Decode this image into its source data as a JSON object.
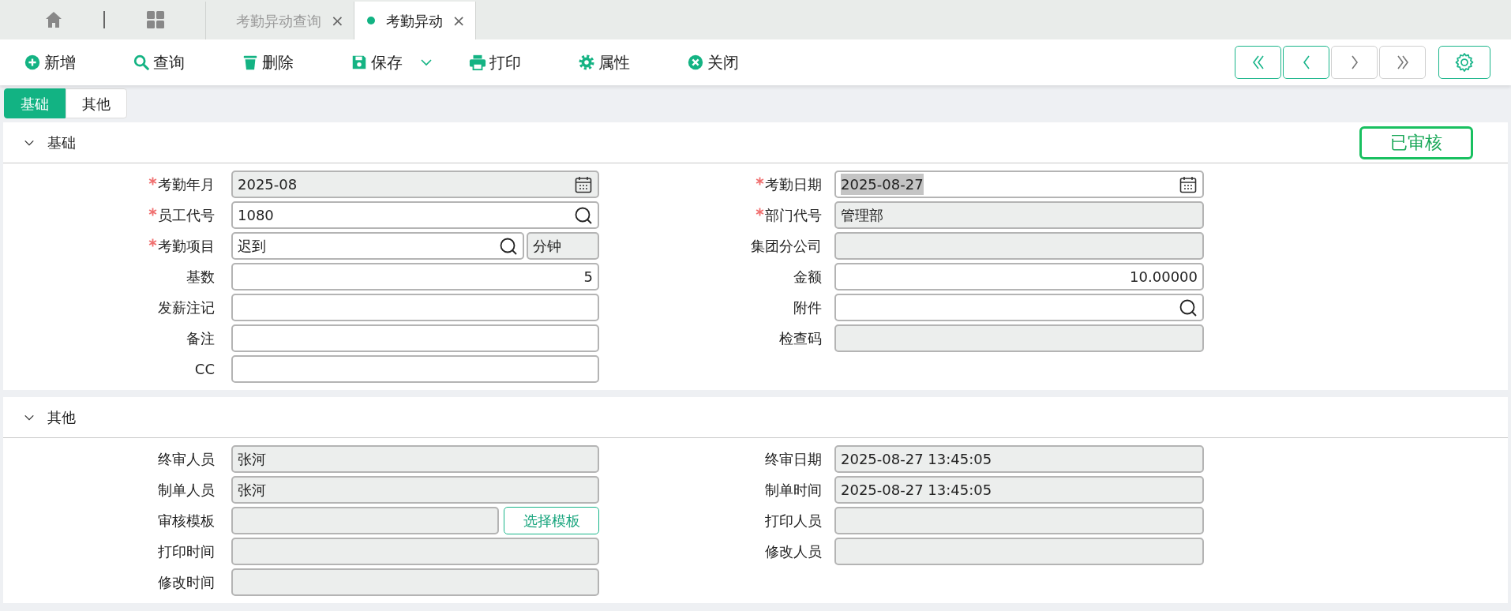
{
  "tabs": [
    {
      "label": "考勤异动查询",
      "close": "×",
      "selected": false
    },
    {
      "label": "考勤异动",
      "close": "×",
      "selected": true
    }
  ],
  "toolbar": [
    {
      "kind": "add",
      "label": "新增",
      "has_menu": false
    },
    {
      "kind": "search",
      "label": "查询",
      "has_menu": false
    },
    {
      "kind": "delete",
      "label": "删除",
      "has_menu": false
    },
    {
      "kind": "save",
      "label": "保存",
      "has_menu": true
    },
    {
      "kind": "print",
      "label": "打印",
      "has_menu": false
    },
    {
      "kind": "properties",
      "label": "属性",
      "has_menu": false
    },
    {
      "kind": "close",
      "label": "关闭",
      "has_menu": false
    }
  ],
  "pager": [
    {
      "kind": "first",
      "disabled": false
    },
    {
      "kind": "previous",
      "disabled": false
    },
    {
      "kind": "next",
      "disabled": true
    },
    {
      "kind": "last",
      "disabled": true
    }
  ],
  "subtabs": [
    {
      "label": "基础",
      "selected": true
    },
    {
      "label": "其他",
      "selected": false
    }
  ],
  "sections": [
    {
      "title": "基础",
      "expanded": true,
      "status": "已审核",
      "columns": [
        [
          {
            "label": "考勤年月",
            "required": true,
            "kind": "date",
            "value": "2025-08",
            "readonly": true
          },
          {
            "label": "员工代号",
            "required": true,
            "kind": "lookup",
            "value": "1080",
            "readonly": false
          },
          {
            "label": "考勤项目",
            "required": true,
            "kind": "lookup",
            "value": "迟到",
            "unit": "分钟",
            "readonly": false
          },
          {
            "label": "基数",
            "required": false,
            "kind": "number",
            "value": "5",
            "readonly": false
          },
          {
            "label": "发薪注记",
            "required": false,
            "kind": "text",
            "readonly": false
          },
          {
            "label": "备注",
            "required": false,
            "kind": "text",
            "readonly": false
          },
          {
            "label": "CC",
            "required": false,
            "kind": "text",
            "readonly": false
          }
        ],
        [
          {
            "label": "考勤日期",
            "required": true,
            "kind": "date",
            "value": "2025-08-27",
            "readonly": false,
            "text_selected": true
          },
          {
            "label": "部门代号",
            "required": true,
            "kind": "text",
            "value": "管理部",
            "readonly": true
          },
          {
            "label": "集团分公司",
            "required": false,
            "kind": "text",
            "readonly": true
          },
          {
            "label": "金额",
            "required": false,
            "kind": "number",
            "value": "10.00000",
            "readonly": false
          },
          {
            "label": "附件",
            "required": false,
            "kind": "lookup",
            "readonly": false
          },
          {
            "label": "检查码",
            "required": false,
            "kind": "text",
            "readonly": true
          }
        ]
      ]
    },
    {
      "title": "其他",
      "expanded": true,
      "columns": [
        [
          {
            "label": "终审人员",
            "required": false,
            "kind": "text",
            "value": "张河",
            "readonly": true
          },
          {
            "label": "制单人员",
            "required": false,
            "kind": "text",
            "value": "张河",
            "readonly": true
          },
          {
            "label": "审核模板",
            "required": false,
            "kind": "text",
            "button": "选择模板",
            "readonly": true
          },
          {
            "label": "打印时间",
            "required": false,
            "kind": "text",
            "readonly": true
          },
          {
            "label": "修改时间",
            "required": false,
            "kind": "text",
            "readonly": true
          }
        ],
        [
          {
            "label": "终审日期",
            "required": false,
            "kind": "text",
            "value": "2025-08-27 13:45:05",
            "readonly": true
          },
          {
            "label": "制单时间",
            "required": false,
            "kind": "text",
            "value": "2025-08-27 13:45:05",
            "readonly": true
          },
          {
            "label": "打印人员",
            "required": false,
            "kind": "text",
            "readonly": true
          },
          {
            "label": "修改人员",
            "required": false,
            "kind": "text",
            "readonly": true
          }
        ]
      ]
    }
  ]
}
